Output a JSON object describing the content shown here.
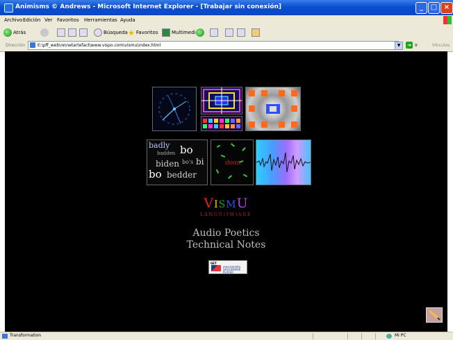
{
  "window": {
    "title": "Animisms © Andrews - Microsoft Internet Explorer - [Trabajar sin conexión]",
    "buttons": {
      "minimize": "_",
      "maximize": "□",
      "close": "×"
    }
  },
  "menu": {
    "items": [
      "Archivo",
      "Edición",
      "Ver",
      "Favoritos",
      "Herramientas",
      "Ayuda"
    ]
  },
  "toolbar": {
    "back": "Atrás",
    "search": "Búsqueda",
    "favorites": "Favoritos",
    "multimedia": "Multimedia"
  },
  "address": {
    "label": "Dirección",
    "url": "E:\\pff_web\\re\\netartefact\\www.vispo.com\\vismu\\index.html",
    "go": "Ir",
    "links": "Vínculos"
  },
  "page": {
    "words_thumb": {
      "w1": "badly",
      "w2": "badden",
      "w3": "bo",
      "w4": "biden",
      "w5": "bo's",
      "w6": "bi",
      "w7": "bo",
      "w8": "bedder"
    },
    "dots_thumb": {
      "label": "doon"
    },
    "title_letters": [
      {
        "char": "V",
        "color": "#e02020"
      },
      {
        "char": "I",
        "color": "#f0d000"
      },
      {
        "char": "S",
        "color": "#20a020"
      },
      {
        "char": "M",
        "color": "#3050ff"
      },
      {
        "char": "U",
        "color": "#b040e0"
      }
    ],
    "subtitle": "LANGU(IM)AGE",
    "links": {
      "audio_poetics": "Audio Poetics",
      "technical_notes": "Technical Notes"
    },
    "player_badge": {
      "label": "GET",
      "brand": "macromedia SHOCKWAVE PLAYER"
    }
  },
  "status": {
    "text": "Transformation",
    "zone": "Mi PC"
  },
  "colors": {
    "titlebar": "#0a4fd1",
    "content_bg": "#000000",
    "link_text": "#bdbdbd",
    "subtitle": "#c02020"
  }
}
